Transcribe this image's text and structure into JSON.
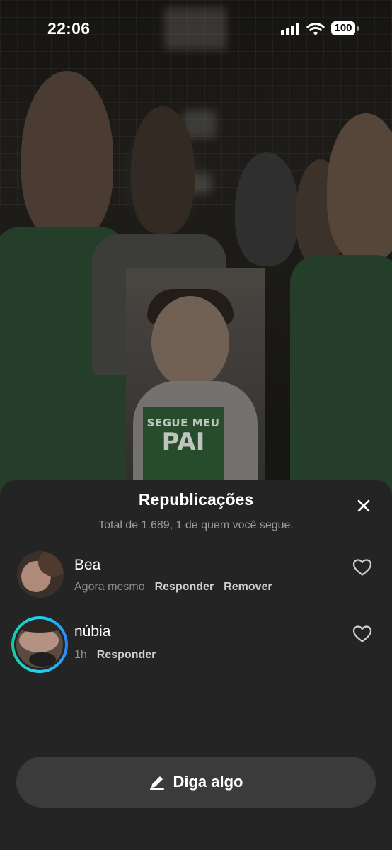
{
  "status_bar": {
    "time": "22:06",
    "battery": "100"
  },
  "background": {
    "sign_line1": "SEGUE MEU",
    "sign_line2": "PAI"
  },
  "sheet": {
    "title": "Republicações",
    "subtitle": "Total de 1.689, 1 de quem você segue.",
    "items": [
      {
        "name": "Bea",
        "time": "Agora mesmo",
        "reply": "Responder",
        "remove": "Remover"
      },
      {
        "name": "núbia",
        "time": "1h",
        "reply": "Responder"
      }
    ],
    "compose_label": "Diga algo"
  },
  "colors": {
    "sheet_bg": "#242424",
    "button_bg": "#3b3b3b",
    "story_ring": "#20d5ec"
  }
}
